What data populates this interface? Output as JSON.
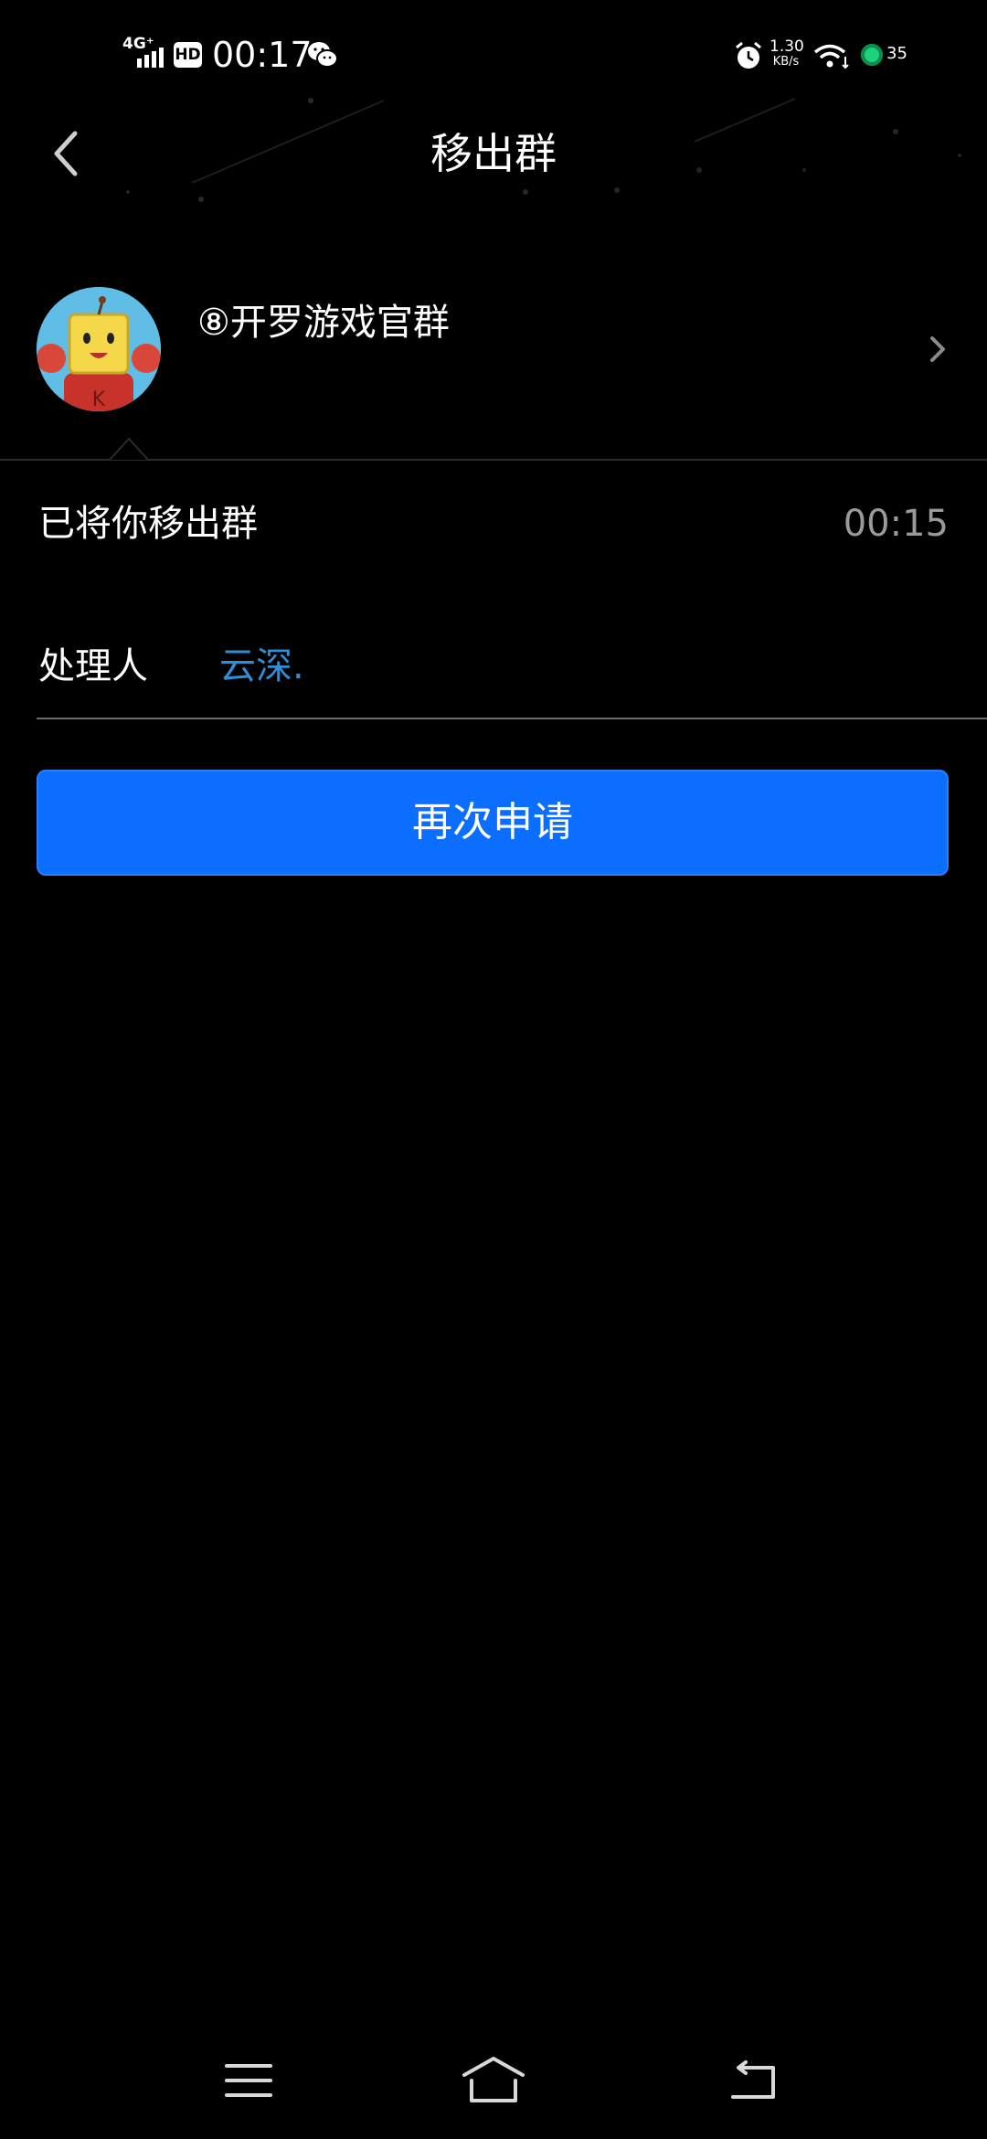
{
  "status_bar": {
    "network": "4G⁺",
    "hd_badge": "HD",
    "time": "00:17",
    "net_speed_value": "1.30",
    "net_speed_unit": "KB/s",
    "battery": "35",
    "icons": [
      "signal-icon",
      "wechat-icon",
      "alarm-icon",
      "wifi-icon",
      "battery-icon"
    ]
  },
  "header": {
    "title": "移出群",
    "back_icon": "chevron-left-icon"
  },
  "group": {
    "name": "⑧开罗游戏官群",
    "avatar_icon": "group-avatar",
    "chevron_icon": "chevron-right-icon"
  },
  "notice": {
    "message": "已将你移出群",
    "time": "00:15"
  },
  "handler": {
    "label": "处理人",
    "name": "云深."
  },
  "actions": {
    "reapply_label": "再次申请",
    "button_color": "#0b6eff"
  },
  "nav_bar": {
    "icons": [
      "menu-icon",
      "home-icon",
      "back-icon"
    ]
  }
}
